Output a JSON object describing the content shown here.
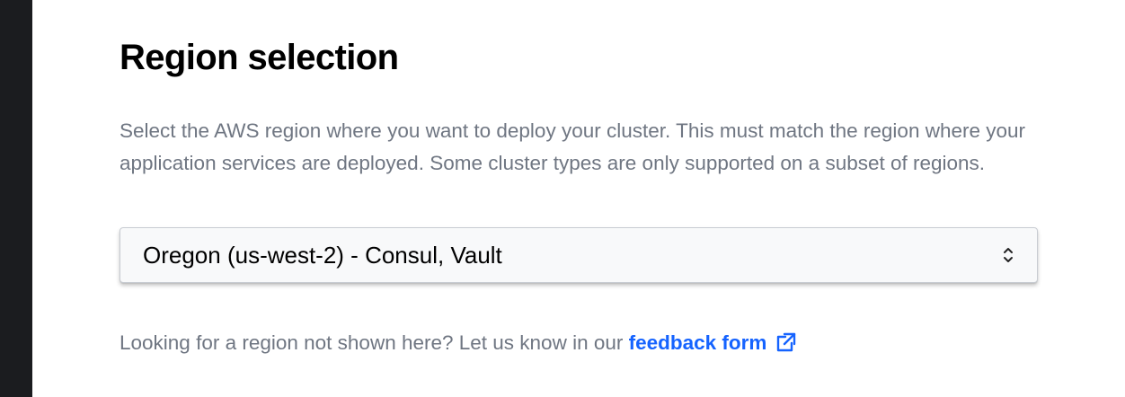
{
  "region": {
    "title": "Region selection",
    "description": "Select the AWS region where you want to deploy your cluster. This must match the region where your application services are deployed. Some cluster types are only supported on a subset of regions.",
    "select": {
      "value": "Oregon (us-west-2) - Consul, Vault",
      "icon": "chevron-up-down-icon"
    },
    "footer": {
      "prefix": "Looking for a region not shown here? Let us know in our",
      "link_label": "feedback form",
      "link_icon": "external-link-icon"
    }
  },
  "colors": {
    "text_primary": "#000000",
    "text_muted": "#6f7682",
    "link": "#1563ff",
    "left_rail": "#1b1c1f",
    "select_background": "#f8f9fa",
    "select_border": "#c8ccd2"
  }
}
